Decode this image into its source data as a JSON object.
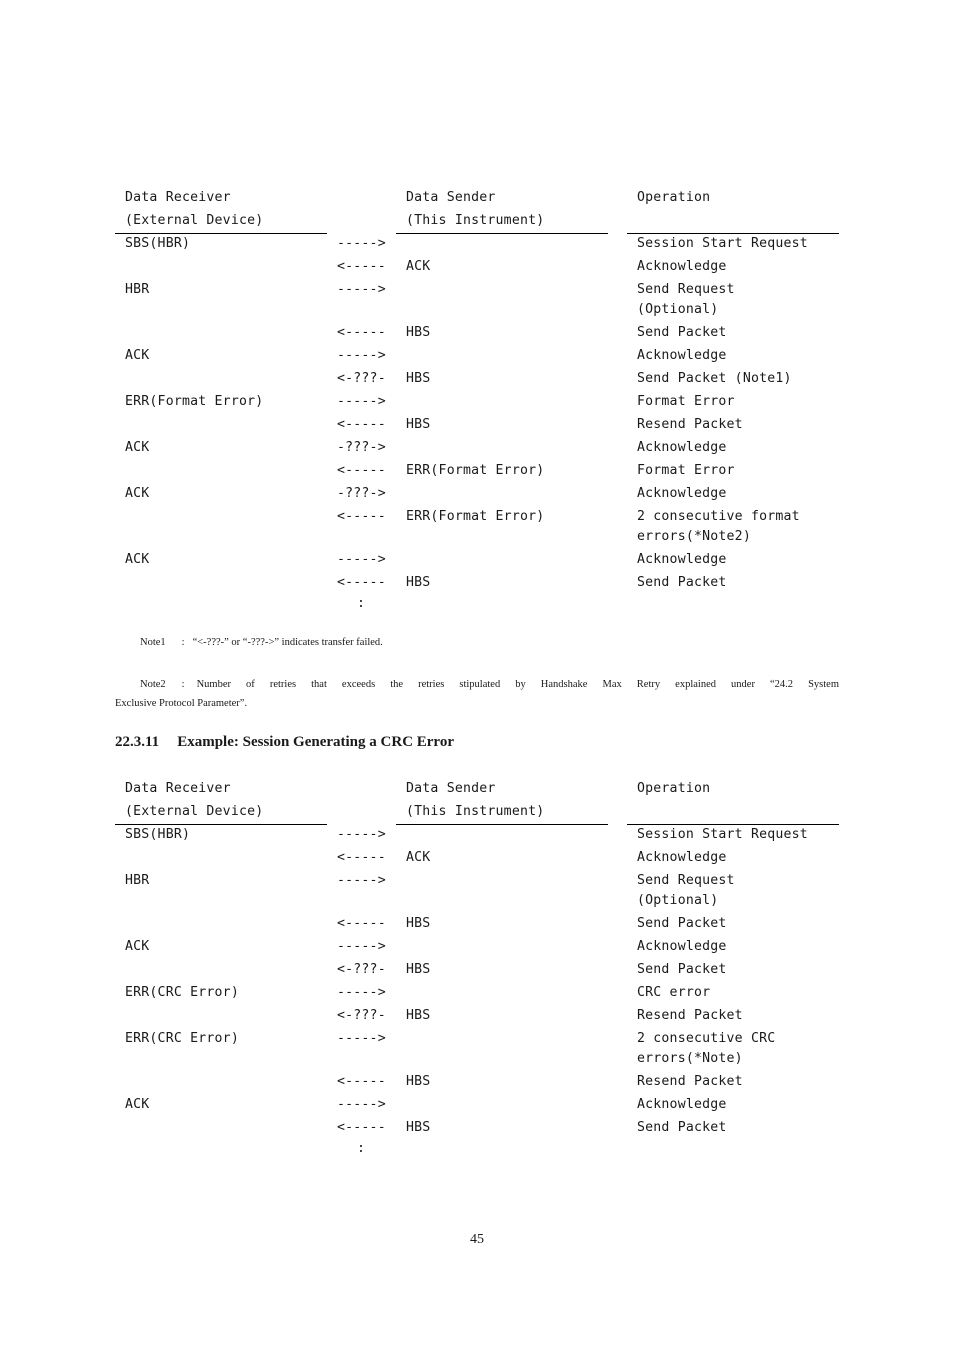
{
  "table1": {
    "headers": {
      "receiver_line1": "Data Receiver",
      "receiver_line2": "(External Device)",
      "sender_line1": "Data Sender",
      "sender_line2": "(This Instrument)",
      "operation": "Operation"
    },
    "rows": [
      {
        "receiver": "SBS(HBR)",
        "arrow": "----->",
        "sender": "",
        "operation": "Session Start Request"
      },
      {
        "receiver": "",
        "arrow": "<-----",
        "sender": "ACK",
        "operation": "Acknowledge"
      },
      {
        "receiver": "HBR",
        "arrow": "----->",
        "sender": "",
        "operation": "Send Request\n(Optional)"
      },
      {
        "receiver": "",
        "arrow": "<-----",
        "sender": "HBS",
        "operation": "Send Packet"
      },
      {
        "receiver": "ACK",
        "arrow": "----->",
        "sender": "",
        "operation": "Acknowledge"
      },
      {
        "receiver": "",
        "arrow": "<-???-",
        "sender": "HBS",
        "operation": "Send Packet (Note1)"
      },
      {
        "receiver": "ERR(Format Error)",
        "arrow": "----->",
        "sender": "",
        "operation": "Format Error"
      },
      {
        "receiver": "",
        "arrow": "<-----",
        "sender": "HBS",
        "operation": "Resend Packet"
      },
      {
        "receiver": "ACK",
        "arrow": "-???->",
        "sender": "",
        "operation": "Acknowledge"
      },
      {
        "receiver": "",
        "arrow": "<-----",
        "sender": "ERR(Format Error)",
        "operation": "Format Error"
      },
      {
        "receiver": "ACK",
        "arrow": "-???->",
        "sender": "",
        "operation": "Acknowledge"
      },
      {
        "receiver": "",
        "arrow": "<-----",
        "sender": "ERR(Format Error)",
        "operation": "2 consecutive format\nerrors(*Note2)"
      },
      {
        "receiver": "ACK",
        "arrow": "----->",
        "sender": "",
        "operation": "Acknowledge"
      },
      {
        "receiver": "",
        "arrow": "<-----",
        "sender": "HBS",
        "operation": "Send Packet"
      }
    ],
    "continuation": ":"
  },
  "notes": {
    "note1_label": "Note1",
    "note1_sep": ":",
    "note1_text": "“<-???-” or “-???->” indicates transfer failed.",
    "note2_label": "Note2",
    "note2_sep": ":",
    "note2_text_line1": "Number of retries that exceeds the retries stipulated by Handshake Max Retry explained under “24.2 System",
    "note2_text_line2": "Exclusive Protocol Parameter”."
  },
  "section": {
    "number": "22.3.11",
    "title": "Example: Session Generating a CRC Error"
  },
  "table2": {
    "headers": {
      "receiver_line1": "Data Receiver",
      "receiver_line2": "(External Device)",
      "sender_line1": "Data Sender",
      "sender_line2": "(This Instrument)",
      "operation": "Operation"
    },
    "rows": [
      {
        "receiver": "SBS(HBR)",
        "arrow": "----->",
        "sender": "",
        "operation": "Session Start Request"
      },
      {
        "receiver": "",
        "arrow": "<-----",
        "sender": "ACK",
        "operation": "Acknowledge"
      },
      {
        "receiver": "HBR",
        "arrow": "----->",
        "sender": "",
        "operation": "Send Request\n(Optional)"
      },
      {
        "receiver": "",
        "arrow": "<-----",
        "sender": "HBS",
        "operation": "Send Packet"
      },
      {
        "receiver": "ACK",
        "arrow": "----->",
        "sender": "",
        "operation": "Acknowledge"
      },
      {
        "receiver": "",
        "arrow": "<-???-",
        "sender": "HBS",
        "operation": "Send Packet"
      },
      {
        "receiver": "ERR(CRC Error)",
        "arrow": "----->",
        "sender": "",
        "operation": "CRC error"
      },
      {
        "receiver": "",
        "arrow": "<-???-",
        "sender": "HBS",
        "operation": "Resend Packet"
      },
      {
        "receiver": "ERR(CRC Error)",
        "arrow": "----->",
        "sender": "",
        "operation": "2 consecutive CRC\nerrors(*Note)"
      },
      {
        "receiver": "",
        "arrow": "<-----",
        "sender": "HBS",
        "operation": "Resend Packet"
      },
      {
        "receiver": "ACK",
        "arrow": "----->",
        "sender": "",
        "operation": "Acknowledge"
      },
      {
        "receiver": "",
        "arrow": "<-----",
        "sender": "HBS",
        "operation": "Send Packet"
      }
    ],
    "continuation": ":"
  },
  "footer": {
    "page_number": "45"
  }
}
